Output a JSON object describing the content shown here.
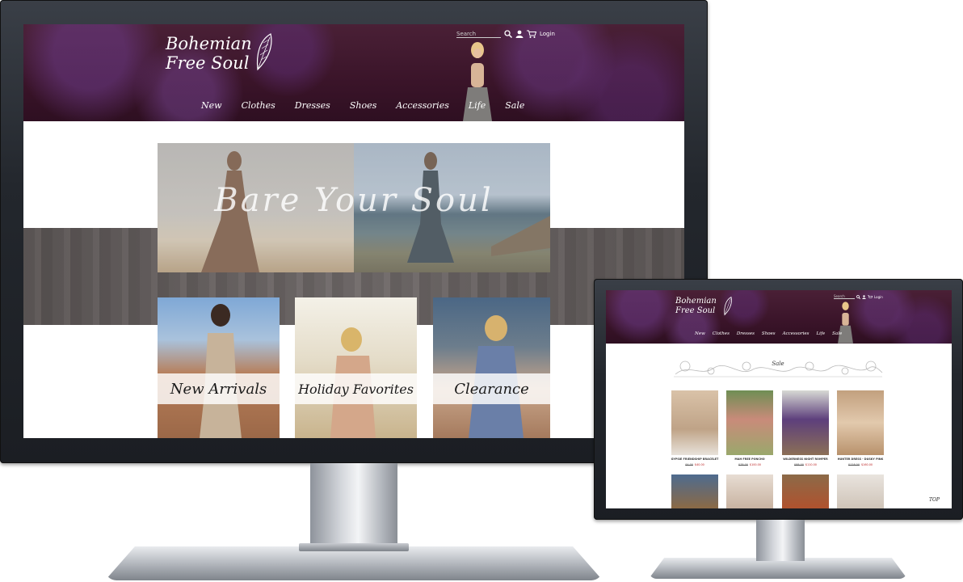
{
  "site": {
    "logo_line1": "Bohemian",
    "logo_line2": "Free Soul",
    "search_placeholder": "Search",
    "login_label": "Login",
    "nav": [
      "New",
      "Clothes",
      "Dresses",
      "Shoes",
      "Accessories",
      "Life",
      "Sale"
    ]
  },
  "desktop_view": {
    "hero_title": "Bare Your Soul",
    "tiles": [
      "New Arrivals",
      "Holiday Favorites",
      "Clearance"
    ]
  },
  "mobile_view": {
    "section_title": "Sale",
    "products": [
      {
        "name": "GYPSIE FRIENDSHIP BRACELET",
        "old_price": "$4.00",
        "price": "$40.00"
      },
      {
        "name": "MAH FREE PONCHO",
        "old_price": "$78.00",
        "price": "$100.00"
      },
      {
        "name": "WILDERNESS NIGHT ROMPER",
        "old_price": "$88.00",
        "price": "$110.00"
      },
      {
        "name": "HUNTER DRESS - DUSKY PINK",
        "old_price": "$128.00",
        "price": "$160.00"
      }
    ],
    "back_to_top": "TOP"
  }
}
